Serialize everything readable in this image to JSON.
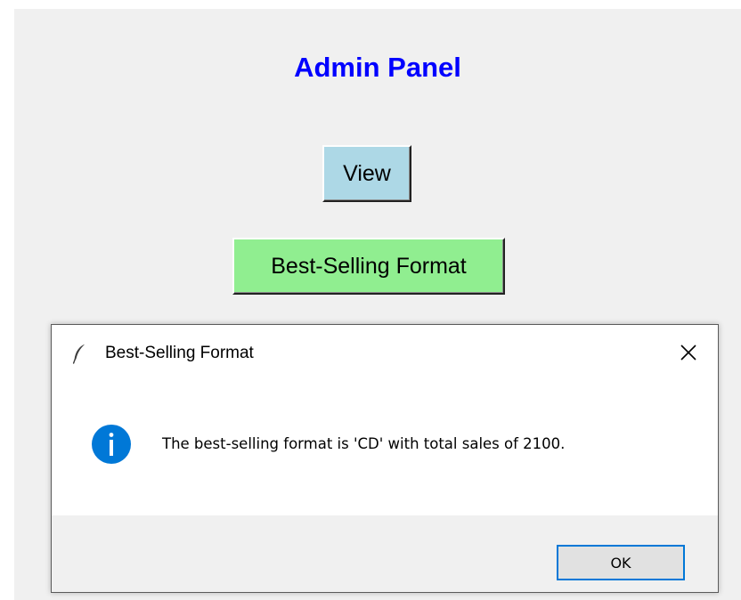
{
  "main_window": {
    "title": "Admin Panel",
    "buttons": {
      "view_label": "View",
      "best_selling_label": "Best-Selling Format"
    }
  },
  "dialog": {
    "title": "Best-Selling Format",
    "app_icon": "feather-icon",
    "message_icon": "info-icon",
    "message": "The best-selling format is 'CD' with total sales of 2100.",
    "ok_label": "OK"
  },
  "colors": {
    "title_text": "#0000ff",
    "view_button_bg": "#add8e6",
    "best_selling_button_bg": "#90ee90",
    "window_bg": "#f0f0f0",
    "info_icon": "#0078d7",
    "ok_focus_border": "#0078d7"
  }
}
